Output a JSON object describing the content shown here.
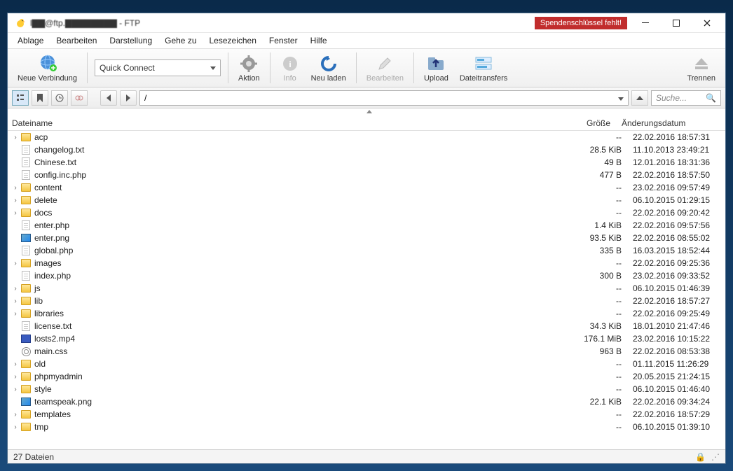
{
  "title": "l▇▇@ftp.▇▇▇▇▇▇▇▇ - FTP",
  "warning": "Spendenschlüssel fehlt!",
  "menu": [
    "Ablage",
    "Bearbeiten",
    "Darstellung",
    "Gehe zu",
    "Lesezeichen",
    "Fenster",
    "Hilfe"
  ],
  "toolbar": {
    "new_connection": "Neue Verbindung",
    "quick_connect": "Quick Connect",
    "action": "Aktion",
    "info": "Info",
    "reload": "Neu laden",
    "edit": "Bearbeiten",
    "upload": "Upload",
    "transfers": "Dateitransfers",
    "disconnect": "Trennen"
  },
  "path": "/",
  "search_placeholder": "Suche...",
  "columns": {
    "name": "Dateiname",
    "size": "Größe",
    "date": "Änderungsdatum"
  },
  "files": [
    {
      "type": "folder",
      "name": "acp",
      "size": "--",
      "date": "22.02.2016 18:57:31"
    },
    {
      "type": "file",
      "name": "changelog.txt",
      "size": "28.5 KiB",
      "date": "11.10.2013 23:49:21"
    },
    {
      "type": "file",
      "name": "Chinese.txt",
      "size": "49 B",
      "date": "12.01.2016 18:31:36"
    },
    {
      "type": "file",
      "name": "config.inc.php",
      "size": "477 B",
      "date": "22.02.2016 18:57:50"
    },
    {
      "type": "folder",
      "name": "content",
      "size": "--",
      "date": "23.02.2016 09:57:49"
    },
    {
      "type": "folder",
      "name": "delete",
      "size": "--",
      "date": "06.10.2015 01:29:15"
    },
    {
      "type": "folder",
      "name": "docs",
      "size": "--",
      "date": "22.02.2016 09:20:42"
    },
    {
      "type": "file",
      "name": "enter.php",
      "size": "1.4 KiB",
      "date": "22.02.2016 09:57:56"
    },
    {
      "type": "image",
      "name": "enter.png",
      "size": "93.5 KiB",
      "date": "22.02.2016 08:55:02"
    },
    {
      "type": "file",
      "name": "global.php",
      "size": "335 B",
      "date": "16.03.2015 18:52:44"
    },
    {
      "type": "folder",
      "name": "images",
      "size": "--",
      "date": "22.02.2016 09:25:36"
    },
    {
      "type": "file",
      "name": "index.php",
      "size": "300 B",
      "date": "23.02.2016 09:33:52"
    },
    {
      "type": "folder",
      "name": "js",
      "size": "--",
      "date": "06.10.2015 01:46:39"
    },
    {
      "type": "folder",
      "name": "lib",
      "size": "--",
      "date": "22.02.2016 18:57:27"
    },
    {
      "type": "folder",
      "name": "libraries",
      "size": "--",
      "date": "22.02.2016 09:25:49"
    },
    {
      "type": "file",
      "name": "license.txt",
      "size": "34.3 KiB",
      "date": "18.01.2010 21:47:46"
    },
    {
      "type": "video",
      "name": "losts2.mp4",
      "size": "176.1 MiB",
      "date": "23.02.2016 10:15:22"
    },
    {
      "type": "css",
      "name": "main.css",
      "size": "963 B",
      "date": "22.02.2016 08:53:38"
    },
    {
      "type": "folder",
      "name": "old",
      "size": "--",
      "date": "01.11.2015 11:26:29"
    },
    {
      "type": "folder",
      "name": "phpmyadmin",
      "size": "--",
      "date": "20.05.2015 21:24:15"
    },
    {
      "type": "folder",
      "name": "style",
      "size": "--",
      "date": "06.10.2015 01:46:40"
    },
    {
      "type": "image",
      "name": "teamspeak.png",
      "size": "22.1 KiB",
      "date": "22.02.2016 09:34:24"
    },
    {
      "type": "folder",
      "name": "templates",
      "size": "--",
      "date": "22.02.2016 18:57:29"
    },
    {
      "type": "folder",
      "name": "tmp",
      "size": "--",
      "date": "06.10.2015 01:39:10"
    }
  ],
  "status": "27 Dateien"
}
